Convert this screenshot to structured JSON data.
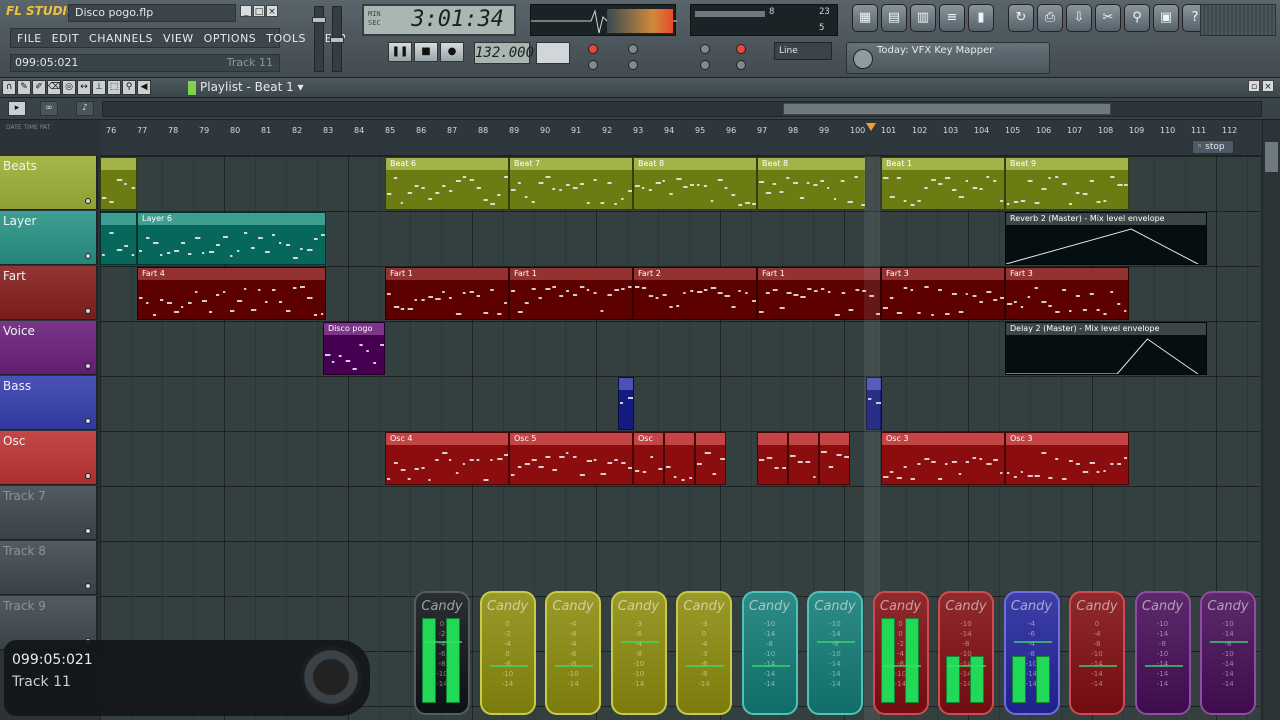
{
  "app": {
    "logo": "FL STUDIO",
    "filename": "Disco pogo.flp"
  },
  "window_buttons": [
    "_",
    "□",
    "×"
  ],
  "menu": [
    "FILE",
    "EDIT",
    "CHANNELS",
    "VIEW",
    "OPTIONS",
    "TOOLS",
    "HELP"
  ],
  "hint": {
    "time": "099:05:021",
    "track": "Track 11"
  },
  "time_display": {
    "value": "3:01:34",
    "labels": "MIN\nSEC"
  },
  "tempo": "132.000",
  "transport": {
    "pause": "❚❚",
    "stop": "■",
    "record": "●"
  },
  "snap": {
    "value": "Line"
  },
  "cpu": {
    "value": "8",
    "poly": "23",
    "ram": "5"
  },
  "hint_panel": {
    "text": "Today: VFX Key Mapper"
  },
  "toolbar_icons": [
    "playlist-icon",
    "piano-roll-icon",
    "channel-rack-icon",
    "mixer-icon",
    "browser-icon",
    "undo-icon",
    "save-icon",
    "render-icon",
    "cut-icon",
    "zoom-icon",
    "project-info-icon",
    "help-icon"
  ],
  "toolbar_glyphs": [
    "▦",
    "▤",
    "▥",
    "≡",
    "▮",
    "↻",
    "⎙",
    "⇩",
    "✂",
    "⚲",
    "▣",
    "?"
  ],
  "playlist": {
    "title": "Playlist - Beat 1",
    "ruler_labels": "DATE  TIME  PAT"
  },
  "ruler_numbers": [
    "76",
    "77",
    "78",
    "79",
    "80",
    "81",
    "82",
    "83",
    "84",
    "85",
    "86",
    "87",
    "88",
    "89",
    "90",
    "91",
    "92",
    "93",
    "94",
    "95",
    "96",
    "97",
    "98",
    "99",
    "100",
    "101",
    "102",
    "103",
    "104",
    "105",
    "106",
    "107",
    "108",
    "109",
    "110",
    "111",
    "112"
  ],
  "stop_marker": "stop",
  "tracks": [
    {
      "name": "Beats",
      "color": "#a7b84a"
    },
    {
      "name": "Layer",
      "color": "#3e9e91"
    },
    {
      "name": "Fart",
      "color": "#923535"
    },
    {
      "name": "Voice",
      "color": "#7a3688"
    },
    {
      "name": "Bass",
      "color": "#4a52b8"
    },
    {
      "name": "Osc",
      "color": "#c44848"
    },
    {
      "name": "Track 7",
      "color": "#525c60"
    },
    {
      "name": "Track 8",
      "color": "#525c60"
    },
    {
      "name": "Track 9",
      "color": "#525c60"
    }
  ],
  "clips": [
    {
      "track": 0,
      "label": "",
      "start": 0,
      "len": 1.2,
      "color": "#a3b34a"
    },
    {
      "track": 0,
      "label": "Beat 6",
      "start": 9.2,
      "len": 4,
      "color": "#a3b34a"
    },
    {
      "track": 0,
      "label": "Beat 7",
      "start": 13.2,
      "len": 4,
      "color": "#a3b34a"
    },
    {
      "track": 0,
      "label": "Beat 8",
      "start": 17.2,
      "len": 4,
      "color": "#a3b34a"
    },
    {
      "track": 0,
      "label": "Beat 8",
      "start": 21.2,
      "len": 3.5,
      "color": "#a3b34a"
    },
    {
      "track": 0,
      "label": "Beat 1",
      "start": 25.2,
      "len": 4,
      "color": "#a3b34a"
    },
    {
      "track": 0,
      "label": "Beat 9",
      "start": 29.2,
      "len": 4,
      "color": "#a3b34a"
    },
    {
      "track": 1,
      "label": "",
      "start": 0,
      "len": 1.2,
      "color": "#3e9e91"
    },
    {
      "track": 1,
      "label": "Layer 6",
      "start": 1.2,
      "len": 6.1,
      "color": "#3e9e91"
    },
    {
      "track": 1,
      "label": "Reverb 2 (Master) - Mix level envelope",
      "start": 29.2,
      "len": 6.5,
      "color": "#3c4548"
    },
    {
      "track": 2,
      "label": "Fart 4",
      "start": 1.2,
      "len": 6.1,
      "color": "#943232"
    },
    {
      "track": 2,
      "label": "Fart 1",
      "start": 9.2,
      "len": 4,
      "color": "#943232"
    },
    {
      "track": 2,
      "label": "Fart 1",
      "start": 13.2,
      "len": 4,
      "color": "#943232"
    },
    {
      "track": 2,
      "label": "Fart 2",
      "start": 17.2,
      "len": 4,
      "color": "#943232"
    },
    {
      "track": 2,
      "label": "Fart 1",
      "start": 21.2,
      "len": 4,
      "color": "#943232"
    },
    {
      "track": 2,
      "label": "Fart 3",
      "start": 25.2,
      "len": 4,
      "color": "#943232"
    },
    {
      "track": 2,
      "label": "Fart 3",
      "start": 29.2,
      "len": 4,
      "color": "#943232"
    },
    {
      "track": 3,
      "label": "Disco pogo",
      "start": 7.2,
      "len": 2,
      "color": "#7c3589"
    },
    {
      "track": 3,
      "label": "Delay 2 (Master) - Mix level envelope",
      "start": 29.2,
      "len": 6.5,
      "color": "#3c4548"
    },
    {
      "track": 4,
      "label": "",
      "start": 16.7,
      "len": 0.5,
      "color": "#4a52b8"
    },
    {
      "track": 4,
      "label": "",
      "start": 24.7,
      "len": 0.5,
      "color": "#4a52b8"
    },
    {
      "track": 5,
      "label": "Osc 4",
      "start": 9.2,
      "len": 4,
      "color": "#c24444"
    },
    {
      "track": 5,
      "label": "Osc 5",
      "start": 13.2,
      "len": 4,
      "color": "#c24444"
    },
    {
      "track": 5,
      "label": "Osc",
      "start": 17.2,
      "len": 1,
      "color": "#c24444"
    },
    {
      "track": 5,
      "label": "",
      "start": 18.2,
      "len": 1,
      "color": "#c24444"
    },
    {
      "track": 5,
      "label": "",
      "start": 19.2,
      "len": 1,
      "color": "#c24444"
    },
    {
      "track": 5,
      "label": "",
      "start": 21.2,
      "len": 1,
      "color": "#c24444"
    },
    {
      "track": 5,
      "label": "",
      "start": 22.2,
      "len": 1,
      "color": "#c24444"
    },
    {
      "track": 5,
      "label": "",
      "start": 23.2,
      "len": 1,
      "color": "#c24444"
    },
    {
      "track": 5,
      "label": "Osc 3",
      "start": 25.2,
      "len": 4,
      "color": "#c24444"
    },
    {
      "track": 5,
      "label": "Osc 3",
      "start": 29.2,
      "len": 4,
      "color": "#c24444"
    }
  ],
  "mixer": [
    {
      "name": "Candy",
      "color": "#2a2f31",
      "border": "#555d61",
      "scale": "0\n-2\n-4\n-6\n-8\n-10\n-14",
      "meter": 0.82
    },
    {
      "name": "Candy",
      "color": "#9a9a2a",
      "border": "#c9c94a",
      "scale": "0\n-2\n-4\n0\n-6\n-10\n-14",
      "meter": 0
    },
    {
      "name": "Candy",
      "color": "#9a9a2a",
      "border": "#c9c94a",
      "scale": "-4\n-8\n-4\n-6\n-8\n-10\n-14",
      "meter": 0
    },
    {
      "name": "Candy",
      "color": "#9a9a2a",
      "border": "#c9c94a",
      "scale": "-3\n-6\n-4\n-8\n-10\n-10\n-14",
      "meter": 0
    },
    {
      "name": "Candy",
      "color": "#9a9a2a",
      "border": "#c9c94a",
      "scale": "-3\n0\n-4\n-3\n-6\n-8\n-14",
      "meter": 0
    },
    {
      "name": "Candy",
      "color": "#2f8b86",
      "border": "#4fc3bb",
      "scale": "-10\n-14\n-8\n-10\n-14\n-14\n-14",
      "meter": 0
    },
    {
      "name": "Candy",
      "color": "#2f8b86",
      "border": "#4fc3bb",
      "scale": "-10\n-14\n-8\n-10\n-14\n-14\n-14",
      "meter": 0
    },
    {
      "name": "Candy",
      "color": "#8f2a2e",
      "border": "#d04b4f",
      "scale": "0\n0\n-2\n-4\n-8\n-10\n-14",
      "meter": 0.82
    },
    {
      "name": "Candy",
      "color": "#8f2a2e",
      "border": "#d04b4f",
      "scale": "-10\n-14\n-8\n-10\n-14\n-14\n-14",
      "meter": 0.45
    },
    {
      "name": "Candy",
      "color": "#3d3fa8",
      "border": "#6b6fe0",
      "scale": "-4\n-6\n-4\n-8\n-10\n-14\n-14",
      "meter": 0.45
    },
    {
      "name": "Candy",
      "color": "#8f2a2e",
      "border": "#d04b4f",
      "scale": "0\n-4\n-8\n-10\n-14\n-14\n-14",
      "meter": 0
    },
    {
      "name": "Candy",
      "color": "#5c2a6a",
      "border": "#8e4da0",
      "scale": "-10\n-14\n-8\n-10\n-14\n-14\n-14",
      "meter": 0
    },
    {
      "name": "Candy",
      "color": "#5c2a6a",
      "border": "#8e4da0",
      "scale": "-10\n-14\n-8\n-10\n-14\n-14\n-14",
      "meter": 0
    }
  ]
}
